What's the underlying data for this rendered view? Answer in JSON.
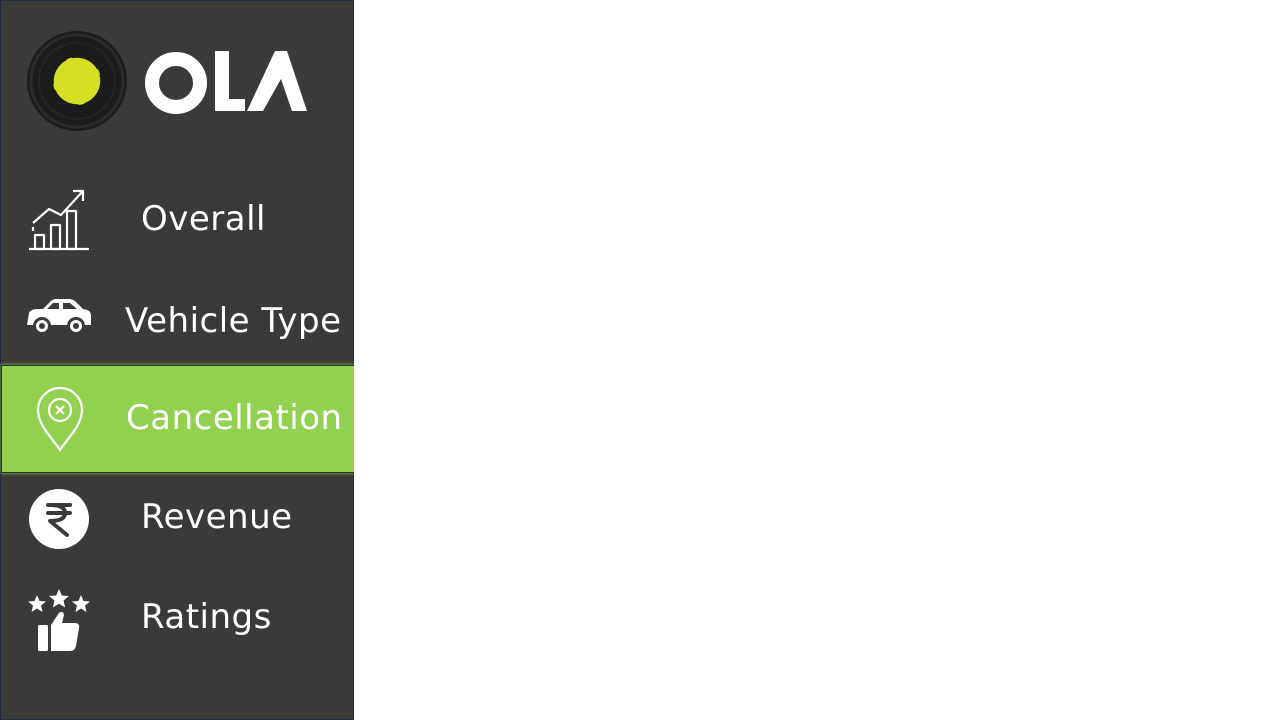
{
  "brand": {
    "name": "OLA",
    "accent": "#d4e024",
    "sidebar_bg": "#3a3a38",
    "active_bg": "#92d050"
  },
  "nav": {
    "items": [
      {
        "label": "Overall",
        "icon": "growth-chart-icon",
        "active": false
      },
      {
        "label": "Vehicle Type",
        "icon": "car-icon",
        "active": false
      },
      {
        "label": "Cancellation",
        "icon": "location-cancel-icon",
        "active": true
      },
      {
        "label": "Revenue",
        "icon": "rupee-icon",
        "active": false
      },
      {
        "label": "Ratings",
        "icon": "stars-thumbs-up-icon",
        "active": false
      }
    ]
  }
}
